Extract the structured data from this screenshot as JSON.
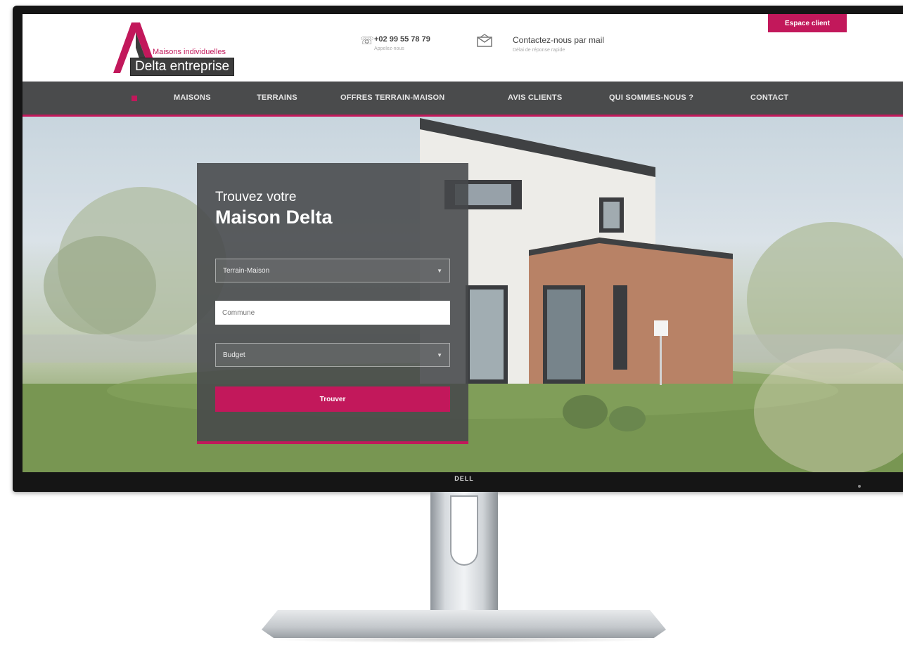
{
  "monitor": {
    "brand": "DELL"
  },
  "header": {
    "logo_tagline": "Maisons individuelles",
    "logo_name": "Delta entreprise",
    "phone": {
      "number": "+02 99 55 78 79",
      "subtitle": "Appelez-nous"
    },
    "mail": {
      "title": "Contactez-nous par mail",
      "subtitle": "Délai de réponse rapide"
    },
    "client_button": "Espace client"
  },
  "nav": {
    "items": [
      {
        "label": "MAISONS"
      },
      {
        "label": "TERRAINS"
      },
      {
        "label": "OFFRES TERRAIN-MAISON"
      },
      {
        "label": "AVIS CLIENTS"
      },
      {
        "label": "QUI SOMMES-NOUS ?"
      },
      {
        "label": "CONTACT"
      }
    ]
  },
  "search": {
    "title_line1": "Trouvez votre",
    "title_line2": "Maison Delta",
    "type_select": "Terrain-Maison",
    "commune_placeholder": "Commune",
    "budget_select": "Budget",
    "submit_label": "Trouver"
  },
  "colors": {
    "accent": "#c2185b",
    "nav_bg": "#4a4b4c",
    "panel_bg": "#46484a"
  },
  "icons": {
    "phone": "phone-icon",
    "mail": "mail-icon",
    "home": "home-icon",
    "caret": "chevron-down-icon"
  }
}
